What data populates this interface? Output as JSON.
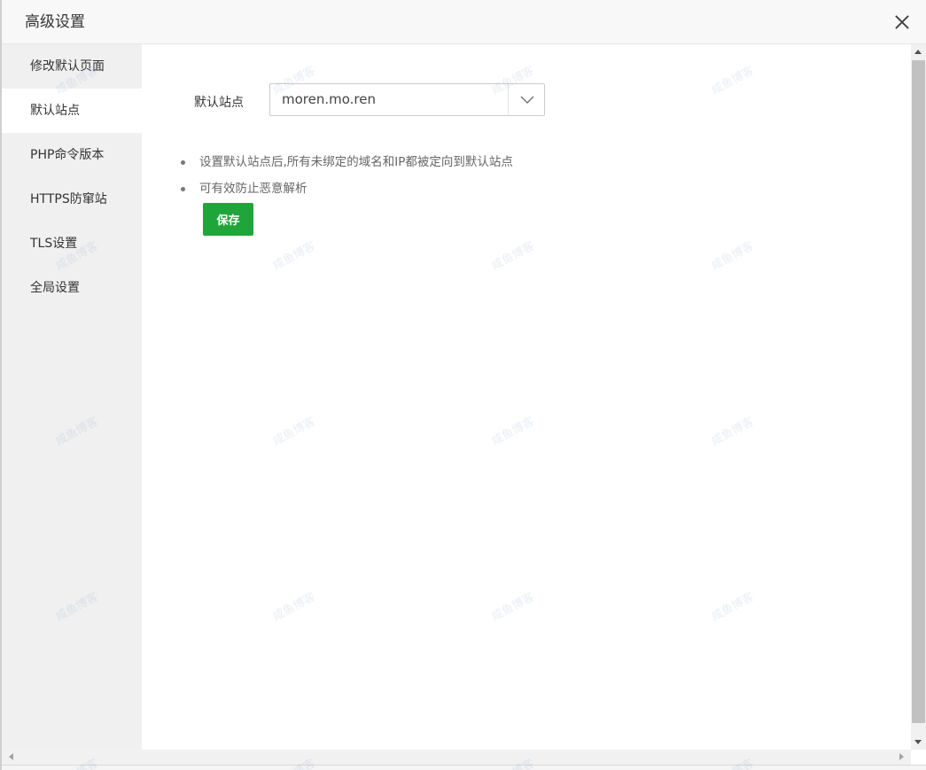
{
  "dialog": {
    "title": "高级设置",
    "close_icon": "close-icon"
  },
  "sidebar": {
    "items": [
      {
        "label": "修改默认页面",
        "active": false
      },
      {
        "label": "默认站点",
        "active": true
      },
      {
        "label": "PHP命令版本",
        "active": false
      },
      {
        "label": "HTTPS防窜站",
        "active": false
      },
      {
        "label": "TLS设置",
        "active": false
      },
      {
        "label": "全局设置",
        "active": false
      }
    ]
  },
  "main": {
    "default_site_label": "默认站点",
    "default_site_value": "moren.mo.ren",
    "dropdown_icon": "chevron-down-icon",
    "notes": [
      "设置默认站点后,所有未绑定的域名和IP都被定向到默认站点",
      "可有效防止恶意解析"
    ],
    "save_label": "保存",
    "save_color": "#20a53a"
  },
  "watermark": {
    "text": "咸鱼博客",
    "logo": "watermark-logo"
  }
}
